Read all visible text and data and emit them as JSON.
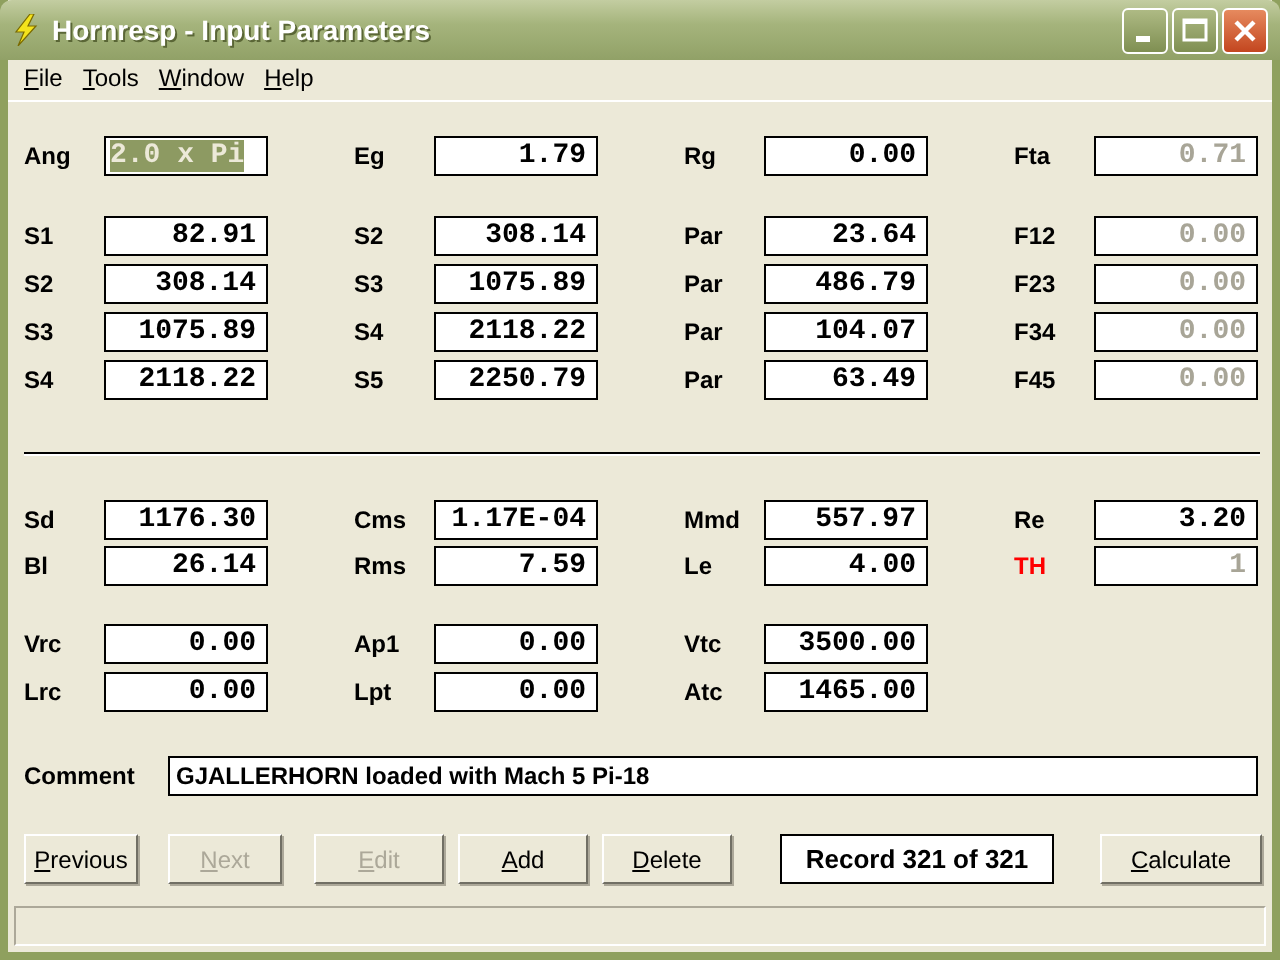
{
  "window": {
    "title": "Hornresp - Input Parameters"
  },
  "menu": [
    {
      "label": "File",
      "underline_first": true
    },
    {
      "label": "Tools",
      "underline_first": true
    },
    {
      "label": "Window",
      "underline_first": true
    },
    {
      "label": "Help",
      "underline_first": true
    }
  ],
  "groups": [
    [
      [
        {
          "label": "Ang",
          "value": "2.0 x Pi",
          "selected": true,
          "disabled": false,
          "alert": false
        },
        {
          "label": "Eg",
          "value": "1.79",
          "selected": false,
          "disabled": false,
          "alert": false
        },
        {
          "label": "Rg",
          "value": "0.00",
          "selected": false,
          "disabled": false,
          "alert": false
        },
        {
          "label": "Fta",
          "value": "0.71",
          "selected": false,
          "disabled": true,
          "alert": false
        }
      ]
    ],
    [
      [
        {
          "label": "S1",
          "value": "82.91",
          "selected": false,
          "disabled": false,
          "alert": false
        },
        {
          "label": "S2",
          "value": "308.14",
          "selected": false,
          "disabled": false,
          "alert": false
        },
        {
          "label": "Par",
          "value": "23.64",
          "selected": false,
          "disabled": false,
          "alert": false
        },
        {
          "label": "F12",
          "value": "0.00",
          "selected": false,
          "disabled": true,
          "alert": false
        }
      ],
      [
        {
          "label": "S2",
          "value": "308.14",
          "selected": false,
          "disabled": false,
          "alert": false
        },
        {
          "label": "S3",
          "value": "1075.89",
          "selected": false,
          "disabled": false,
          "alert": false
        },
        {
          "label": "Par",
          "value": "486.79",
          "selected": false,
          "disabled": false,
          "alert": false
        },
        {
          "label": "F23",
          "value": "0.00",
          "selected": false,
          "disabled": true,
          "alert": false
        }
      ],
      [
        {
          "label": "S3",
          "value": "1075.89",
          "selected": false,
          "disabled": false,
          "alert": false
        },
        {
          "label": "S4",
          "value": "2118.22",
          "selected": false,
          "disabled": false,
          "alert": false
        },
        {
          "label": "Par",
          "value": "104.07",
          "selected": false,
          "disabled": false,
          "alert": false
        },
        {
          "label": "F34",
          "value": "0.00",
          "selected": false,
          "disabled": true,
          "alert": false
        }
      ],
      [
        {
          "label": "S4",
          "value": "2118.22",
          "selected": false,
          "disabled": false,
          "alert": false
        },
        {
          "label": "S5",
          "value": "2250.79",
          "selected": false,
          "disabled": false,
          "alert": false
        },
        {
          "label": "Par",
          "value": "63.49",
          "selected": false,
          "disabled": false,
          "alert": false
        },
        {
          "label": "F45",
          "value": "0.00",
          "selected": false,
          "disabled": true,
          "alert": false
        }
      ]
    ],
    [
      [
        {
          "label": "Sd",
          "value": "1176.30",
          "selected": false,
          "disabled": false,
          "alert": false
        },
        {
          "label": "Cms",
          "value": "1.17E-04",
          "selected": false,
          "disabled": false,
          "alert": false
        },
        {
          "label": "Mmd",
          "value": "557.97",
          "selected": false,
          "disabled": false,
          "alert": false
        },
        {
          "label": "Re",
          "value": "3.20",
          "selected": false,
          "disabled": false,
          "alert": false
        }
      ],
      [
        {
          "label": "Bl",
          "value": "26.14",
          "selected": false,
          "disabled": false,
          "alert": false
        },
        {
          "label": "Rms",
          "value": "7.59",
          "selected": false,
          "disabled": false,
          "alert": false
        },
        {
          "label": "Le",
          "value": "4.00",
          "selected": false,
          "disabled": false,
          "alert": false
        },
        {
          "label": "TH",
          "value": "1",
          "selected": false,
          "disabled": true,
          "alert": true
        }
      ]
    ],
    [
      [
        {
          "label": "Vrc",
          "value": "0.00",
          "selected": false,
          "disabled": false,
          "alert": false
        },
        {
          "label": "Ap1",
          "value": "0.00",
          "selected": false,
          "disabled": false,
          "alert": false
        },
        {
          "label": "Vtc",
          "value": "3500.00",
          "selected": false,
          "disabled": false,
          "alert": false
        }
      ],
      [
        {
          "label": "Lrc",
          "value": "0.00",
          "selected": false,
          "disabled": false,
          "alert": false
        },
        {
          "label": "Lpt",
          "value": "0.00",
          "selected": false,
          "disabled": false,
          "alert": false
        },
        {
          "label": "Atc",
          "value": "1465.00",
          "selected": false,
          "disabled": false,
          "alert": false
        }
      ]
    ]
  ],
  "comment": {
    "label": "Comment",
    "value": "GJALLERHORN loaded with Mach 5 Pi-18"
  },
  "buttons": [
    {
      "label": "Previous",
      "underline_first": true,
      "disabled": false
    },
    {
      "label": "Next",
      "underline_first": true,
      "disabled": true
    },
    {
      "label": "Edit",
      "underline_first": true,
      "disabled": true
    },
    {
      "label": "Add",
      "underline_first": true,
      "disabled": false
    },
    {
      "label": "Delete",
      "underline_first": true,
      "disabled": false
    }
  ],
  "record": "Record 321 of 321",
  "calculate": {
    "label": "Calculate",
    "underline_first": true,
    "disabled": false
  }
}
